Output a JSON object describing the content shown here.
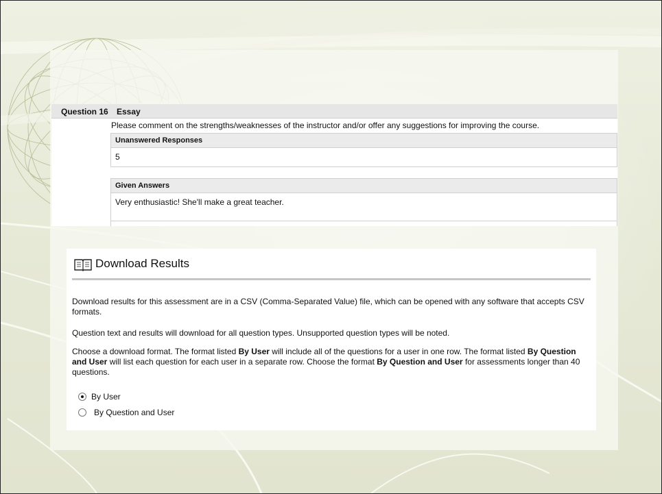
{
  "essay": {
    "question_number": "Question 16",
    "question_type": "Essay",
    "question_text": "Please comment on the strengths/weaknesses of the instructor and/or offer any suggestions for improving the course.",
    "unanswered_header": "Unanswered Responses",
    "unanswered_value": "5",
    "given_header": "Given Answers",
    "answers": [
      "Very enthusiastic! She'll make a great teacher."
    ]
  },
  "download": {
    "title": "Download Results",
    "icon": "book-icon",
    "p1": "Download results for this assessment are in a CSV (Comma-Separated Value) file, which can be opened with any software that accepts CSV formats.",
    "p2": "Question text and results will download for all question types. Unsupported question types will be noted.",
    "p3_parts": [
      {
        "text": "Choose a download format. The format listed ",
        "bold": false
      },
      {
        "text": "By User",
        "bold": true
      },
      {
        "text": " will include all of the questions for a user in one row. The format listed ",
        "bold": false
      },
      {
        "text": "By Question and User",
        "bold": true
      },
      {
        "text": " will list each question for each user in a separate row. Choose the format ",
        "bold": false
      },
      {
        "text": "By Question and User",
        "bold": true
      },
      {
        "text": " for assessments longer than 40 questions.",
        "bold": false
      }
    ],
    "options": [
      {
        "label": "By User",
        "selected": true
      },
      {
        "label": "By Question and User",
        "selected": false
      }
    ]
  },
  "colors": {
    "background": "#e6e9d6",
    "globe_lines": "#b8bc95",
    "header_gray": "#e6e6e6"
  }
}
